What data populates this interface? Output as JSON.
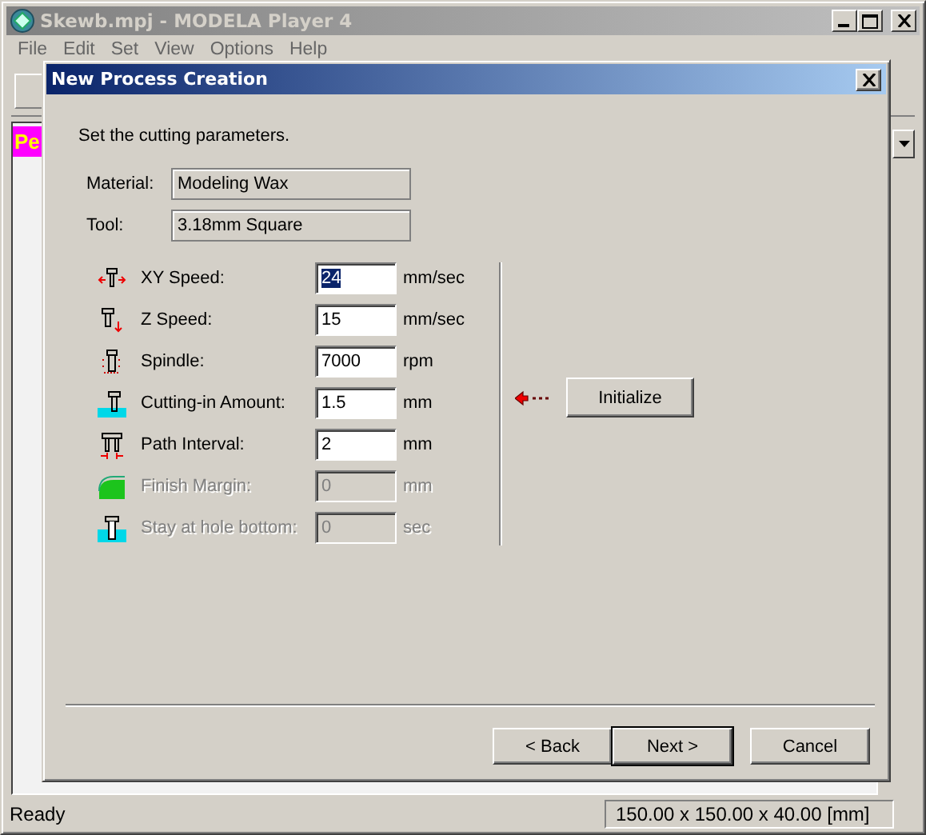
{
  "main_window": {
    "title": "Skewb.mpj - MODELA Player 4",
    "menu": [
      "File",
      "Edit",
      "Set",
      "View",
      "Options",
      "Help"
    ],
    "panel_tab": "Pe",
    "status": "Ready",
    "dimensions": "150.00 x 150.00 x 40.00 [mm]"
  },
  "dialog": {
    "title": "New Process Creation",
    "instruction": "Set the cutting parameters.",
    "info": [
      {
        "label": "Material:",
        "value": "Modeling Wax"
      },
      {
        "label": "Tool:",
        "value": "3.18mm Square"
      }
    ],
    "parameters": [
      {
        "kind": "xy-speed",
        "label": "XY Speed:",
        "value": "24",
        "unit": "mm/sec",
        "disabled": false,
        "selected": true
      },
      {
        "kind": "z-speed",
        "label": "Z Speed:",
        "value": "15",
        "unit": "mm/sec",
        "disabled": false,
        "selected": false
      },
      {
        "kind": "spindle",
        "label": "Spindle:",
        "value": "7000",
        "unit": "rpm",
        "disabled": false,
        "selected": false
      },
      {
        "kind": "cutting-in",
        "label": "Cutting-in Amount:",
        "value": "1.5",
        "unit": "mm",
        "disabled": false,
        "selected": false
      },
      {
        "kind": "path-interval",
        "label": "Path Interval:",
        "value": "2",
        "unit": "mm",
        "disabled": false,
        "selected": false
      },
      {
        "kind": "finish-margin",
        "label": "Finish Margin:",
        "value": "0",
        "unit": "mm",
        "disabled": true,
        "selected": false
      },
      {
        "kind": "hole-bottom",
        "label": "Stay at hole bottom:",
        "value": "0",
        "unit": "sec",
        "disabled": true,
        "selected": false
      }
    ],
    "initialize_button": "Initialize",
    "buttons": [
      {
        "label": "< Back",
        "default": false
      },
      {
        "label": "Next >",
        "default": true
      },
      {
        "label": "Cancel",
        "default": false
      }
    ]
  }
}
